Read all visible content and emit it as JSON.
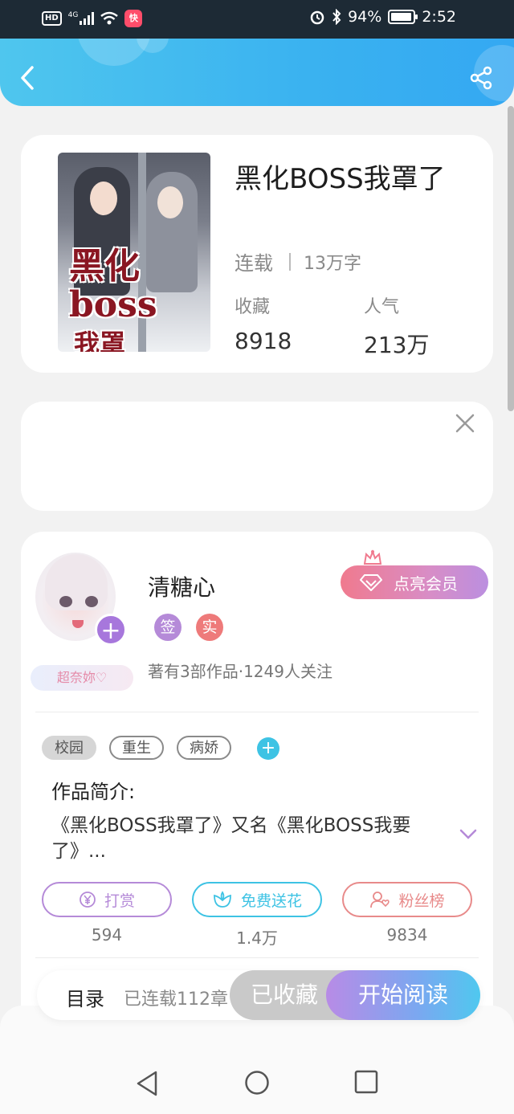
{
  "status_bar": {
    "network": "4G",
    "hd": "HD",
    "battery": "94%",
    "battery_level": 0.94,
    "time": "2:52",
    "app_icon_text": "快"
  },
  "book": {
    "title": "黑化BOSS我罩了",
    "status": "连载",
    "words": "13万字",
    "favorites_label": "收藏",
    "favorites": "8918",
    "popularity_label": "人气",
    "popularity": "213万",
    "cover": {
      "title_line1": "黑化boss",
      "title_line2": "我罩"
    }
  },
  "author": {
    "name": "清糖心",
    "badge_signed": "签",
    "badge_real": "实",
    "info": "著有3部作品·1249人关注",
    "nickname_badge": "超奈妳♡",
    "follow_symbol": "+",
    "vip_label": "点亮会员"
  },
  "genres": [
    {
      "label": "校园",
      "selected": true
    },
    {
      "label": "重生",
      "selected": false
    },
    {
      "label": "病娇",
      "selected": false
    }
  ],
  "genre_add_symbol": "+",
  "intro": {
    "label": "作品简介:",
    "text": "《黑化BOSS我罩了》又名《黑化BOSS我要了》..."
  },
  "actions": [
    {
      "icon": "yen-icon",
      "label": "打赏",
      "count": "594",
      "color": "#b58ad8"
    },
    {
      "icon": "flower-icon",
      "label": "免费送花",
      "count": "1.4万",
      "color": "#3ec3e4"
    },
    {
      "icon": "fan-icon",
      "label": "粉丝榜",
      "count": "9834",
      "color": "#e88a8a"
    }
  ],
  "bottom_bar": {
    "toc_label": "目录",
    "toc_sub": "已连载112章",
    "favorited_label": "已收藏",
    "read_label": "开始阅读"
  }
}
